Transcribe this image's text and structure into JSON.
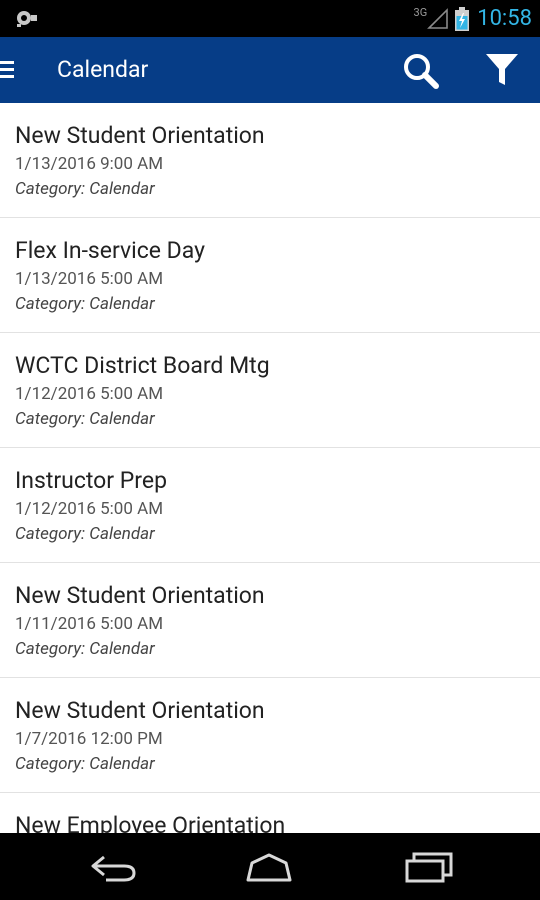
{
  "status_bar": {
    "network_label": "3G",
    "time": "10:58",
    "left_icon": "notification-icon",
    "signal_icon": "signal-icon",
    "battery_icon": "battery-charging-icon"
  },
  "app_bar": {
    "title": "Calendar",
    "menu_icon": "hamburger-menu-icon",
    "search_icon": "search-icon",
    "filter_icon": "filter-icon"
  },
  "events": [
    {
      "title": "New Student Orientation",
      "date": "1/13/2016 9:00 AM",
      "category": "Category: Calendar"
    },
    {
      "title": "Flex In-service Day",
      "date": "1/13/2016 5:00 AM",
      "category": "Category: Calendar"
    },
    {
      "title": "WCTC District Board Mtg",
      "date": "1/12/2016 5:00 AM",
      "category": "Category: Calendar"
    },
    {
      "title": "Instructor Prep",
      "date": "1/12/2016 5:00 AM",
      "category": "Category: Calendar"
    },
    {
      "title": "New Student Orientation",
      "date": "1/11/2016 5:00 AM",
      "category": "Category: Calendar"
    },
    {
      "title": "New Student Orientation",
      "date": "1/7/2016 12:00 PM",
      "category": "Category: Calendar"
    },
    {
      "title": "New Employee Orientation",
      "date": "",
      "category": ""
    }
  ],
  "nav_bar": {
    "back_icon": "back-icon",
    "home_icon": "home-icon",
    "recents_icon": "recent-apps-icon"
  },
  "colors": {
    "app_bar": "#063d87",
    "status_accent": "#33b5e5",
    "background": "#ffffff"
  }
}
